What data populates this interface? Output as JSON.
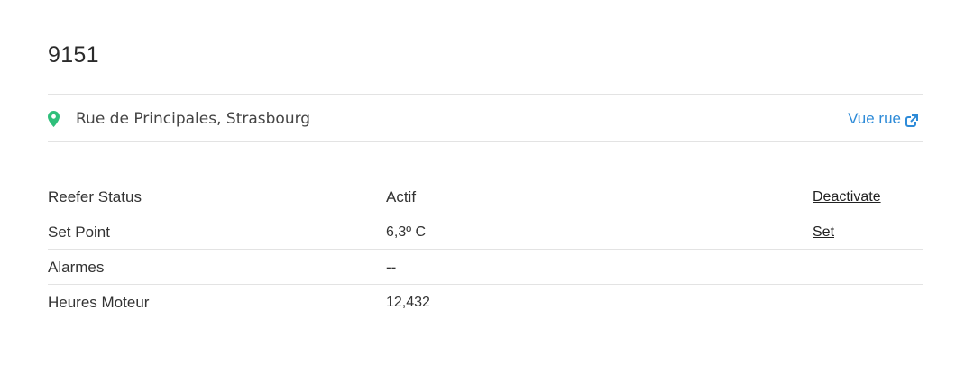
{
  "header": {
    "title": "9151"
  },
  "location": {
    "icon": "map-pin-icon",
    "icon_color": "#2fbf7b",
    "address": "Rue de Principales, Strasbourg",
    "street_view_label": "Vue rue",
    "street_view_icon": "external-link-icon",
    "link_color": "#2e8bd8"
  },
  "details": {
    "rows": [
      {
        "label": "Reefer Status",
        "value": "Actif",
        "action": "Deactivate"
      },
      {
        "label": "Set Point",
        "value": "6,3º C",
        "action": "Set"
      },
      {
        "label": "Alarmes",
        "value": "--",
        "action": ""
      },
      {
        "label": "Heures Moteur",
        "value": "12,432",
        "action": ""
      }
    ]
  }
}
